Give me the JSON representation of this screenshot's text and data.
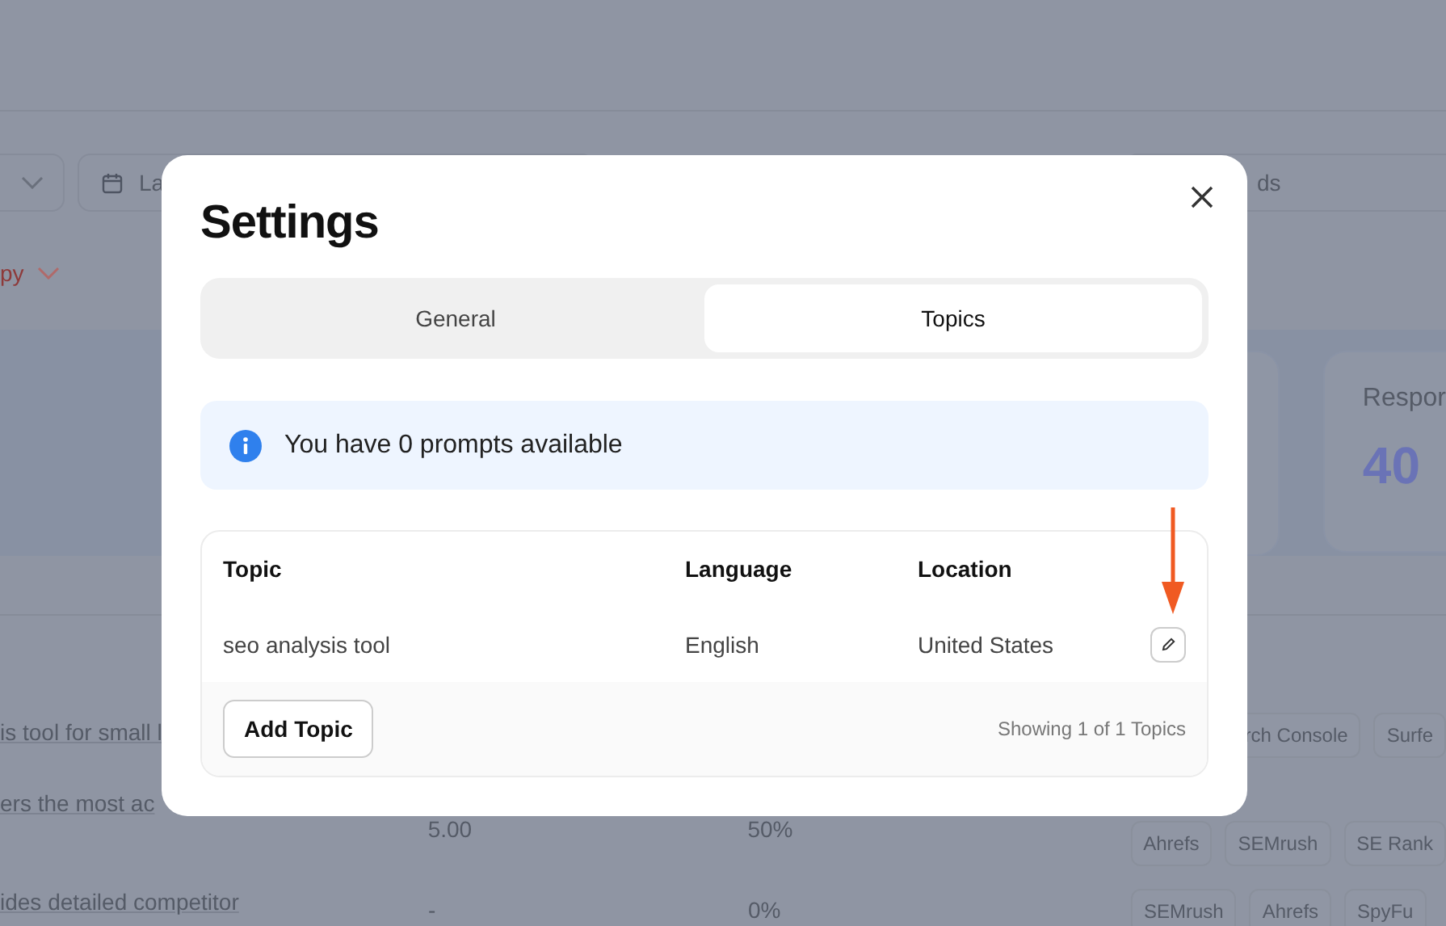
{
  "background": {
    "filters": [
      {
        "kind": "select"
      },
      {
        "kind": "date",
        "label": "La"
      },
      {
        "kind": "search",
        "label": "ds"
      }
    ],
    "sort_link": "py",
    "stat_cards": [
      {
        "kind": "blank"
      },
      {
        "kind": "stat",
        "label": "Respor",
        "value": "40"
      }
    ],
    "rows": [
      {
        "text": "is tool for small l",
        "tags": [
          "rch Console",
          "Surfe"
        ]
      },
      {
        "text": "ers the most ac",
        "score": "5.00",
        "share": "50%",
        "tags": [
          "Ahrefs",
          "SEMrush",
          "SE Rank"
        ]
      },
      {
        "text": "ides detailed competitor",
        "score": "-",
        "share": "0%",
        "tags": [
          "SEMrush",
          "Ahrefs",
          "SpyFu"
        ]
      }
    ]
  },
  "dialog": {
    "title": "Settings",
    "tabs": [
      {
        "label": "General",
        "selected": false
      },
      {
        "label": "Topics",
        "selected": true
      }
    ],
    "notice": "You have 0 prompts available",
    "table": {
      "columns": [
        "Topic",
        "Language",
        "Location"
      ],
      "rows": [
        {
          "topic": "seo analysis tool",
          "language": "English",
          "location": "United States"
        }
      ]
    },
    "add_button": "Add Topic",
    "footer": "Showing 1 of 1 Topics"
  }
}
